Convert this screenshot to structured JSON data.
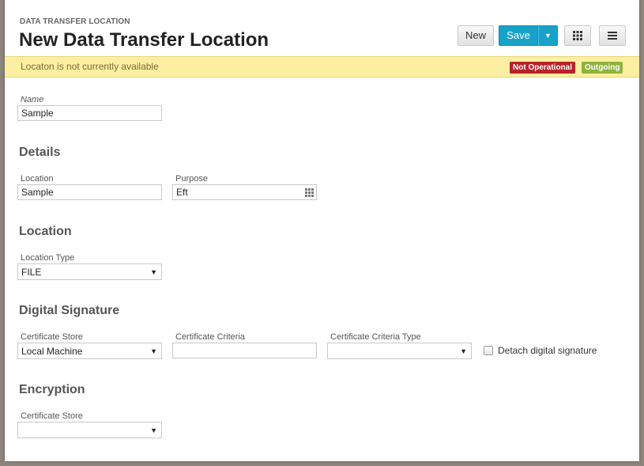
{
  "header": {
    "breadcrumb": "DATA TRANSFER LOCATION",
    "title": "New Data Transfer Location",
    "buttons": {
      "new_label": "New",
      "save_label": "Save",
      "save_dropdown_icon": "caret-down-icon",
      "grid_icon": "grid-icon",
      "menu_icon": "hamburger-menu-icon"
    }
  },
  "alert": {
    "message": "Locaton is not currently available",
    "badges": [
      {
        "label": "Not Operational",
        "color": "#b9222a"
      },
      {
        "label": "Outgoing",
        "color": "#8fb33b"
      }
    ]
  },
  "form": {
    "name": {
      "label": "Name",
      "value": "Sample"
    },
    "details": {
      "heading": "Details",
      "location": {
        "label": "Location",
        "value": "Sample"
      },
      "purpose": {
        "label": "Purpose",
        "value": "Eft",
        "icon": "lookup-grid-icon"
      }
    },
    "location_section": {
      "heading": "Location",
      "location_type": {
        "label": "Location Type",
        "value": "FILE"
      }
    },
    "digital_signature": {
      "heading": "Digital Signature",
      "certificate_store": {
        "label": "Certificate Store",
        "value": "Local Machine"
      },
      "certificate_criteria": {
        "label": "Certificate Criteria",
        "value": ""
      },
      "certificate_criteria_type": {
        "label": "Certificate Criteria Type",
        "value": ""
      },
      "detach": {
        "label": "Detach digital signature",
        "checked": false
      }
    },
    "encryption": {
      "heading": "Encryption",
      "certificate_store": {
        "label": "Certificate Store",
        "value": ""
      }
    }
  },
  "colors": {
    "accent": "#17a2c9",
    "alert_bg": "#fcefa1"
  }
}
